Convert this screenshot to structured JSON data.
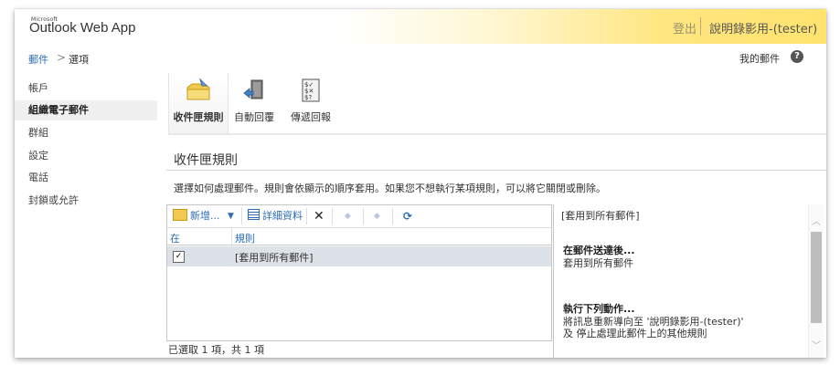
{
  "header": {
    "brand_small": "Microsoft",
    "brand": "Outlook Web App",
    "signout": "登出",
    "username": "說明錄影用-(tester)"
  },
  "breadcrumb": {
    "mail": "郵件",
    "separator": ">",
    "options": "選項",
    "my_mail": "我的郵件",
    "help_icon": "help-icon"
  },
  "nav": {
    "items": [
      {
        "label": "帳戶"
      },
      {
        "label": "組織電子郵件"
      },
      {
        "label": "群組"
      },
      {
        "label": "設定"
      },
      {
        "label": "電話"
      },
      {
        "label": "封鎖或允許"
      }
    ],
    "selected": "組織電子郵件"
  },
  "tabs": [
    {
      "label": "收件匣規則",
      "icon": "inbox-rules-icon"
    },
    {
      "label": "自動回覆",
      "icon": "auto-reply-icon"
    },
    {
      "label": "傳遞回報",
      "icon": "delivery-report-icon"
    }
  ],
  "section": {
    "title": "收件匣規則",
    "description": "選擇如何處理郵件。規則會依顯示的順序套用。如果您不想執行某項規則，可以將它關閉或刪除。"
  },
  "toolbar": {
    "new_label": "新增...",
    "details_label": "詳細資料",
    "delete_icon": "delete-icon",
    "up_icon": "move-up-icon",
    "down_icon": "move-down-icon",
    "refresh_icon": "refresh-icon"
  },
  "list": {
    "columns": [
      "在",
      "規則"
    ],
    "rows": [
      {
        "enabled": true,
        "rule": "[套用到所有郵件]"
      }
    ],
    "status": "已選取 1 項，共 1 項"
  },
  "detail": {
    "title": "[套用到所有郵件]",
    "when_heading": "在郵件送達後...",
    "when_text": "套用到所有郵件",
    "do_heading": "執行下列動作...",
    "do_text_1": "將訊息重新導向至 '說明錄影用-(tester)'",
    "do_text_2": "及 停止處理此郵件上的其他規則"
  },
  "colors": {
    "link": "#2e6db4",
    "header_gold": "#ffe36e",
    "selection": "#dde1e8"
  }
}
